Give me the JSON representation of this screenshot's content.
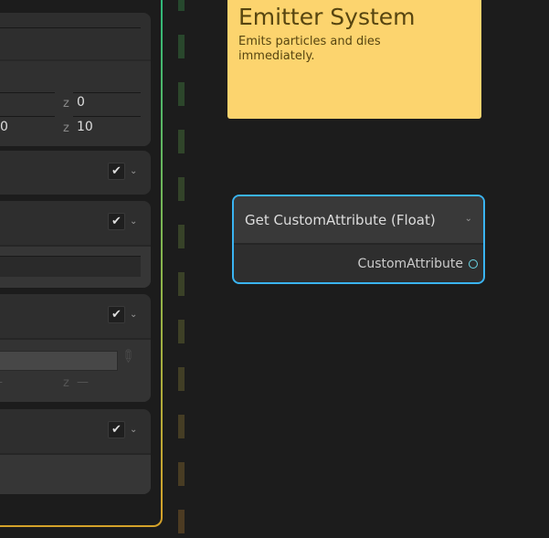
{
  "blocks": [
    {
      "z_labels": [
        "z",
        "z"
      ],
      "values": [
        "0",
        "10"
      ],
      "left_value": "0"
    },
    {
      "enabled": true
    },
    {
      "enabled": true
    },
    {
      "enabled": true,
      "z_label": "z",
      "z_value": "—",
      "left_value": "—"
    },
    {
      "enabled": true
    }
  ],
  "icons": {
    "check": "✔",
    "chevron": "⌄"
  },
  "sticky_note": {
    "title": "Emitter System",
    "body": "Emits particles and dies immediately."
  },
  "node": {
    "title": "Get CustomAttribute (Float)",
    "output_port": "CustomAttribute"
  },
  "colors": {
    "note": "#fcd46e",
    "node_border": "#3ab4f2",
    "port": "#6ad8e8"
  }
}
